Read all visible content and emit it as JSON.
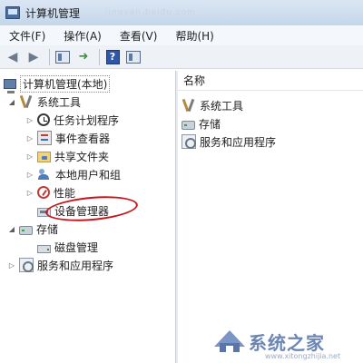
{
  "window": {
    "title": "计算机管理",
    "title_ghost": "jingyan.baidu.com"
  },
  "menu": [
    "文件(F)",
    "操作(A)",
    "查看(V)",
    "帮助(H)"
  ],
  "toolbar": {
    "back_icon": "back-arrow-icon",
    "forward_icon": "forward-arrow-icon",
    "help_label": "?"
  },
  "tree": {
    "root": "计算机管理(本地)",
    "system_tools": "系统工具",
    "task_scheduler": "任务计划程序",
    "event_viewer": "事件查看器",
    "shared_folders": "共享文件夹",
    "local_users": "本地用户和组",
    "performance": "性能",
    "device_manager": "设备管理器",
    "storage": "存储",
    "disk_management": "磁盘管理",
    "services_apps": "服务和应用程序"
  },
  "detail": {
    "column_header": "名称",
    "items": [
      "系统工具",
      "存储",
      "服务和应用程序"
    ]
  },
  "watermark": {
    "text": "系统之家",
    "url": "www.xitongzhijia.net"
  },
  "colors": {
    "annotation": "#c4161c",
    "watermark": "#6b86b4"
  }
}
